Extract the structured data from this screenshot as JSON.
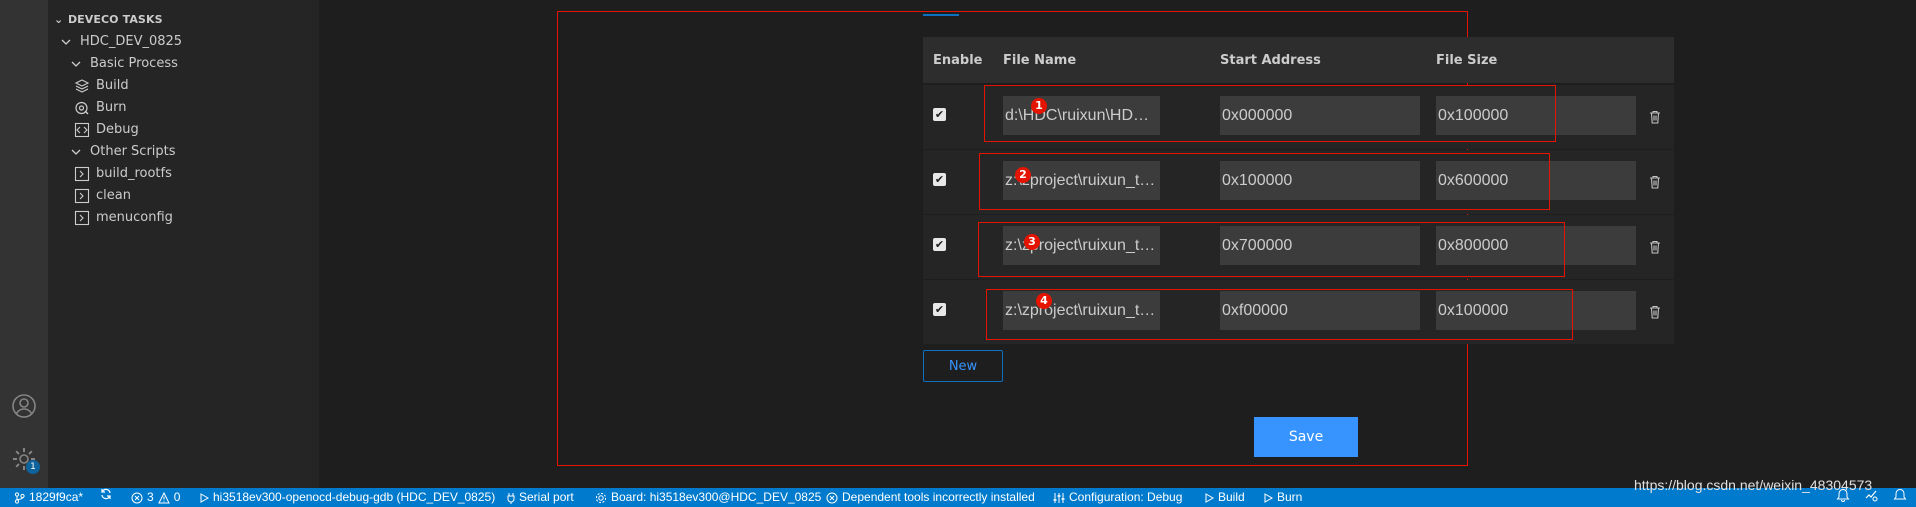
{
  "sidebar": {
    "header": "DEVECO TASKS",
    "project": "HDC_DEV_0825",
    "groups": [
      {
        "label": "Basic Process",
        "items": [
          {
            "label": "Build",
            "icon": "layers-icon"
          },
          {
            "label": "Burn",
            "icon": "burn-icon"
          },
          {
            "label": "Debug",
            "icon": "code-icon"
          }
        ]
      },
      {
        "label": "Other Scripts",
        "items": [
          {
            "label": "build_rootfs",
            "icon": "terminal-icon"
          },
          {
            "label": "clean",
            "icon": "terminal-icon"
          },
          {
            "label": "menuconfig",
            "icon": "terminal-icon"
          }
        ]
      }
    ]
  },
  "activity_bar": {
    "badge": "1",
    "icons": [
      "account-icon",
      "gear-icon"
    ]
  },
  "table": {
    "headers": {
      "enable": "Enable",
      "file_name": "File Name",
      "start_address": "Start Address",
      "file_size": "File Size"
    },
    "rows": [
      {
        "marker": "1",
        "enabled": true,
        "file_name": "d:\\HDC\\ruixun\\HDC\\openocd",
        "start_address": "0x000000",
        "file_size": "0x100000"
      },
      {
        "marker": "2",
        "enabled": true,
        "file_name": "z:\\zproject\\ruixun_test\\u-boot",
        "start_address": "0x100000",
        "file_size": "0x600000"
      },
      {
        "marker": "3",
        "enabled": true,
        "file_name": "z:\\zproject\\ruixun_test\\kernel",
        "start_address": "0x700000",
        "file_size": "0x800000"
      },
      {
        "marker": "4",
        "enabled": true,
        "file_name": "z:\\zproject\\ruixun_test\\rootfs",
        "start_address": "0xf00000",
        "file_size": "0x100000"
      }
    ]
  },
  "buttons": {
    "new": "New",
    "save": "Save"
  },
  "statusbar": {
    "branch": "1829f9ca*",
    "errors": "3",
    "warnings": "0",
    "debug_config": "hi3518ev300-openocd-debug-gdb (HDC_DEV_0825)",
    "serial_port": "Serial port",
    "board": "Board: hi3518ev300@HDC_DEV_0825",
    "dependency": "Dependent tools incorrectly installed",
    "configuration": "Configuration: Debug",
    "build": "Build",
    "burn": "Burn"
  },
  "watermark": "https://blog.csdn.net/weixin_48304573",
  "colors": {
    "accent": "#007acc",
    "annotation": "#e51400",
    "save": "#3794ff"
  }
}
